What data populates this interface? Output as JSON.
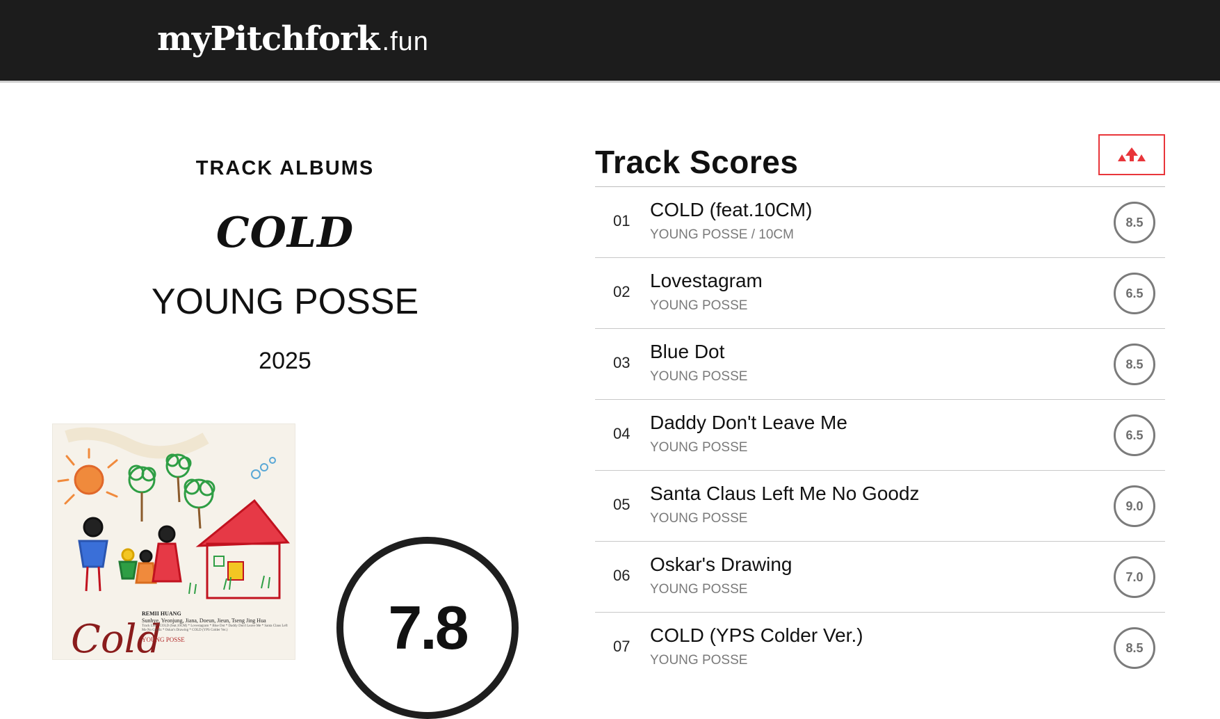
{
  "header": {
    "logo_main": "myPitchfork",
    "logo_suffix": ".fun"
  },
  "album": {
    "section_label": "TRACK ALBUMS",
    "title": "COLD",
    "artist": "YOUNG POSSE",
    "year": "2025",
    "score": "7.8",
    "cover": {
      "lettering": "Cold",
      "credits_line1": "REMII HUANG",
      "credits_line2": "Sunhye, Yeonjung, Jiana, Doeun, Jieun, Tseng Jing Hua",
      "credits_line3": "Track List * COLD (feat.10CM) * Lovestagram * Blue Dot * Daddy Don't Leave Me * Santa Claus Left Me No Goodz * Oskar's Drawing * COLD (YPS Colder Ver.)",
      "credits_line4": "YOUNG POSSE"
    }
  },
  "tracks_section": {
    "heading": "Track Scores",
    "share_icon": "share-icon",
    "accent_color": "#e8353a"
  },
  "tracks": [
    {
      "number": "01",
      "title": "COLD (feat.10CM)",
      "artist": "YOUNG POSSE / 10CM",
      "score": "8.5"
    },
    {
      "number": "02",
      "title": "Lovestagram",
      "artist": "YOUNG POSSE",
      "score": "6.5"
    },
    {
      "number": "03",
      "title": "Blue Dot",
      "artist": "YOUNG POSSE",
      "score": "8.5"
    },
    {
      "number": "04",
      "title": "Daddy Don't Leave Me",
      "artist": "YOUNG POSSE",
      "score": "6.5"
    },
    {
      "number": "05",
      "title": "Santa Claus Left Me No Goodz",
      "artist": "YOUNG POSSE",
      "score": "9.0"
    },
    {
      "number": "06",
      "title": "Oskar's Drawing",
      "artist": "YOUNG POSSE",
      "score": "7.0"
    },
    {
      "number": "07",
      "title": "COLD (YPS Colder Ver.)",
      "artist": "YOUNG POSSE",
      "score": "8.5"
    }
  ]
}
